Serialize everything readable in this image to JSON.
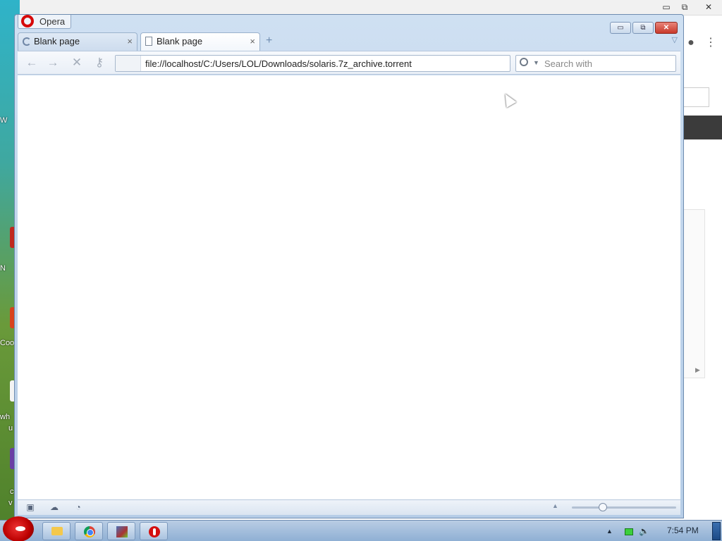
{
  "desktop": {
    "labels": [
      "W",
      "N",
      "Coo",
      "wh",
      "u",
      "c",
      "v"
    ]
  },
  "background_window": {
    "controls": [
      "▭",
      "⧉",
      "✕"
    ]
  },
  "browser": {
    "menu_label": "Opera",
    "window_controls": {
      "minimize": "▭",
      "restore": "⧉",
      "close": "✕"
    },
    "tabs": [
      {
        "label": "Blank page",
        "state": "loading"
      },
      {
        "label": "Blank page",
        "state": "active"
      }
    ],
    "tab_close": "×",
    "new_tab": "+",
    "tab_menu": "▽",
    "nav": {
      "back": "←",
      "forward": "→",
      "stop": "✕",
      "wand": "⚷"
    },
    "address": "file://localhost/C:/Users/LOL/Downloads/solaris.7z_archive.torrent",
    "search_placeholder": "Search with",
    "status_icons": [
      "▣",
      "☁",
      "◔"
    ],
    "zoom_up": "▲"
  },
  "taskbar": {
    "clock": "7:54 PM",
    "tray_up": "▲",
    "tray_volume": "🔈"
  }
}
